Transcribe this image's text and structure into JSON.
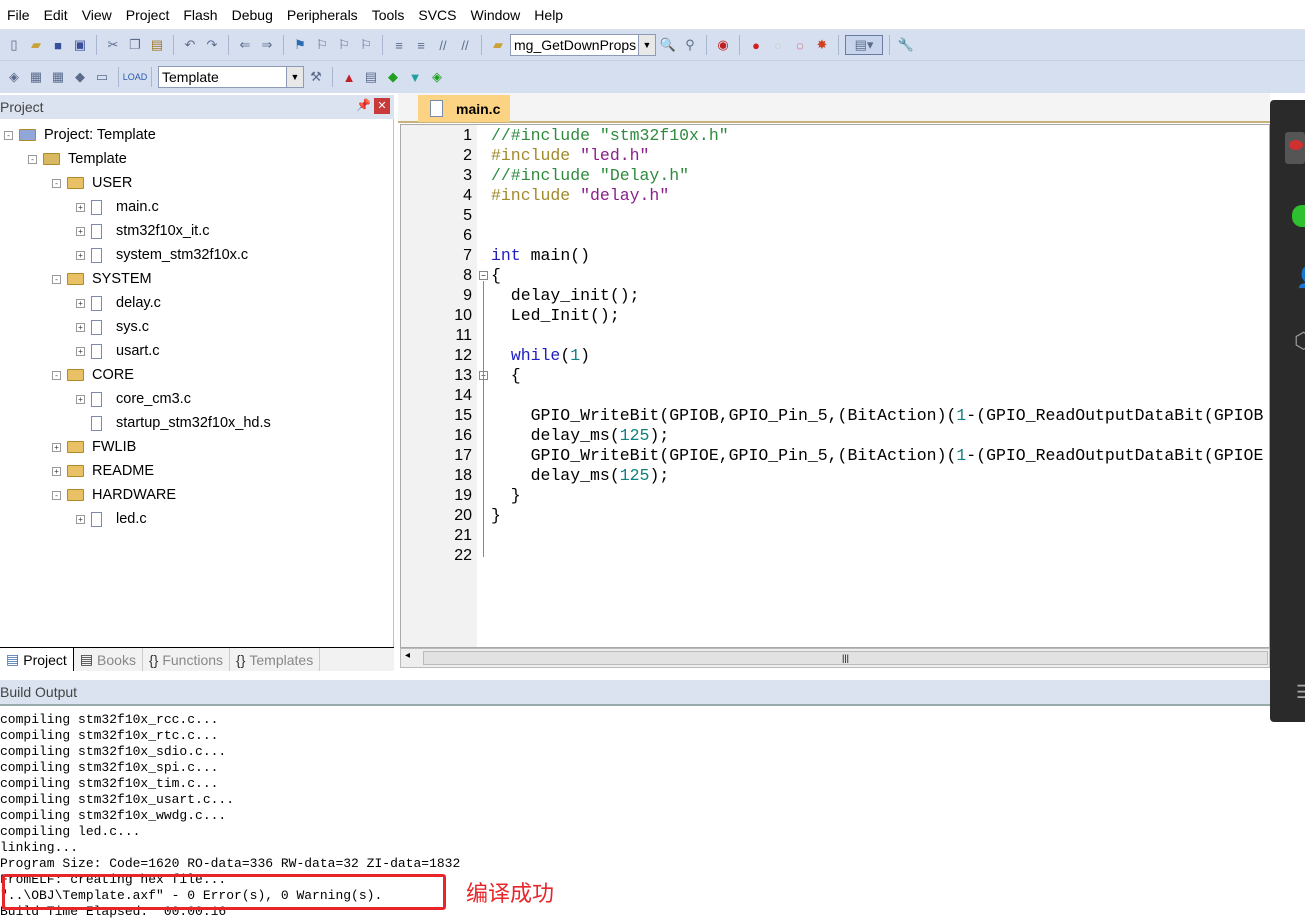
{
  "menu": [
    "File",
    "Edit",
    "View",
    "Project",
    "Flash",
    "Debug",
    "Peripherals",
    "Tools",
    "SVCS",
    "Window",
    "Help"
  ],
  "toolbar": {
    "find_combo": "mg_GetDownProps",
    "target_combo": "Template"
  },
  "project_panel": {
    "title": "Project",
    "tree": [
      {
        "label": "Project: Template",
        "level": 0,
        "kind": "project",
        "exp": "-"
      },
      {
        "label": "Template",
        "level": 1,
        "kind": "target",
        "exp": "-"
      },
      {
        "label": "USER",
        "level": 2,
        "kind": "folder",
        "exp": "-"
      },
      {
        "label": "main.c",
        "level": 3,
        "kind": "file",
        "exp": "+"
      },
      {
        "label": "stm32f10x_it.c",
        "level": 3,
        "kind": "file",
        "exp": "+"
      },
      {
        "label": "system_stm32f10x.c",
        "level": 3,
        "kind": "file",
        "exp": "+"
      },
      {
        "label": "SYSTEM",
        "level": 2,
        "kind": "folder",
        "exp": "-"
      },
      {
        "label": "delay.c",
        "level": 3,
        "kind": "file",
        "exp": "+"
      },
      {
        "label": "sys.c",
        "level": 3,
        "kind": "file",
        "exp": "+"
      },
      {
        "label": "usart.c",
        "level": 3,
        "kind": "file",
        "exp": "+"
      },
      {
        "label": "CORE",
        "level": 2,
        "kind": "folder",
        "exp": "-"
      },
      {
        "label": "core_cm3.c",
        "level": 3,
        "kind": "file",
        "exp": "+"
      },
      {
        "label": "startup_stm32f10x_hd.s",
        "level": 3,
        "kind": "file",
        "exp": ""
      },
      {
        "label": "FWLIB",
        "level": 2,
        "kind": "folder",
        "exp": "+"
      },
      {
        "label": "README",
        "level": 2,
        "kind": "folder",
        "exp": "+"
      },
      {
        "label": "HARDWARE",
        "level": 2,
        "kind": "folder",
        "exp": "-"
      },
      {
        "label": "led.c",
        "level": 3,
        "kind": "file",
        "exp": "+"
      }
    ],
    "tabs": [
      {
        "label": "Project",
        "icon": "project-icon",
        "active": true
      },
      {
        "label": "Books",
        "icon": "books-icon"
      },
      {
        "label": "Functions",
        "icon": "functions-icon",
        "glyph": "{}"
      },
      {
        "label": "Templates",
        "icon": "templates-icon",
        "glyph": "{}"
      }
    ]
  },
  "editor": {
    "tab": "main.c",
    "lines": [
      [
        [
          "comment",
          "//#include \"stm32f10x.h\""
        ]
      ],
      [
        [
          "pp",
          "#include "
        ],
        [
          "string",
          "\"led.h\""
        ]
      ],
      [
        [
          "comment",
          "//#include \"Delay.h\""
        ]
      ],
      [
        [
          "pp",
          "#include "
        ],
        [
          "string",
          "\"delay.h\""
        ]
      ],
      [],
      [],
      [
        [
          "kw",
          "int"
        ],
        [
          "plain",
          " main()"
        ]
      ],
      [
        [
          "plain",
          "{"
        ]
      ],
      [
        [
          "plain",
          "  delay_init();"
        ]
      ],
      [
        [
          "plain",
          "  Led_Init();"
        ]
      ],
      [],
      [
        [
          "plain",
          "  "
        ],
        [
          "kw",
          "while"
        ],
        [
          "plain",
          "("
        ],
        [
          "num",
          "1"
        ],
        [
          "plain",
          ")"
        ]
      ],
      [
        [
          "plain",
          "  {"
        ]
      ],
      [],
      [
        [
          "plain",
          "    GPIO_WriteBit(GPIOB,GPIO_Pin_5,(BitAction)("
        ],
        [
          "num",
          "1"
        ],
        [
          "plain",
          "-(GPIO_ReadOutputDataBit(GPIOB"
        ]
      ],
      [
        [
          "plain",
          "    delay_ms("
        ],
        [
          "num",
          "125"
        ],
        [
          "plain",
          ");"
        ]
      ],
      [
        [
          "plain",
          "    GPIO_WriteBit(GPIOE,GPIO_Pin_5,(BitAction)("
        ],
        [
          "num",
          "1"
        ],
        [
          "plain",
          "-(GPIO_ReadOutputDataBit(GPIOE"
        ]
      ],
      [
        [
          "plain",
          "    delay_ms("
        ],
        [
          "num",
          "125"
        ],
        [
          "plain",
          ");"
        ]
      ],
      [
        [
          "plain",
          "  }"
        ]
      ],
      [
        [
          "plain",
          "}"
        ]
      ],
      [],
      []
    ],
    "fold_lines": [
      8,
      13
    ]
  },
  "build_output": {
    "title": "Build Output",
    "lines": [
      "compiling stm32f10x_rcc.c...",
      "compiling stm32f10x_rtc.c...",
      "compiling stm32f10x_sdio.c...",
      "compiling stm32f10x_spi.c...",
      "compiling stm32f10x_tim.c...",
      "compiling stm32f10x_usart.c...",
      "compiling stm32f10x_wwdg.c...",
      "compiling led.c...",
      "linking...",
      "Program Size: Code=1620 RO-data=336 RW-data=32 ZI-data=1832",
      "FromELF: creating hex file...",
      "\"..\\OBJ\\Template.axf\" - 0 Error(s), 0 Warning(s).",
      "Build Time Elapsed:  00:00:16"
    ],
    "annotation": "编译成功",
    "annotation_color": "#e8262a"
  }
}
